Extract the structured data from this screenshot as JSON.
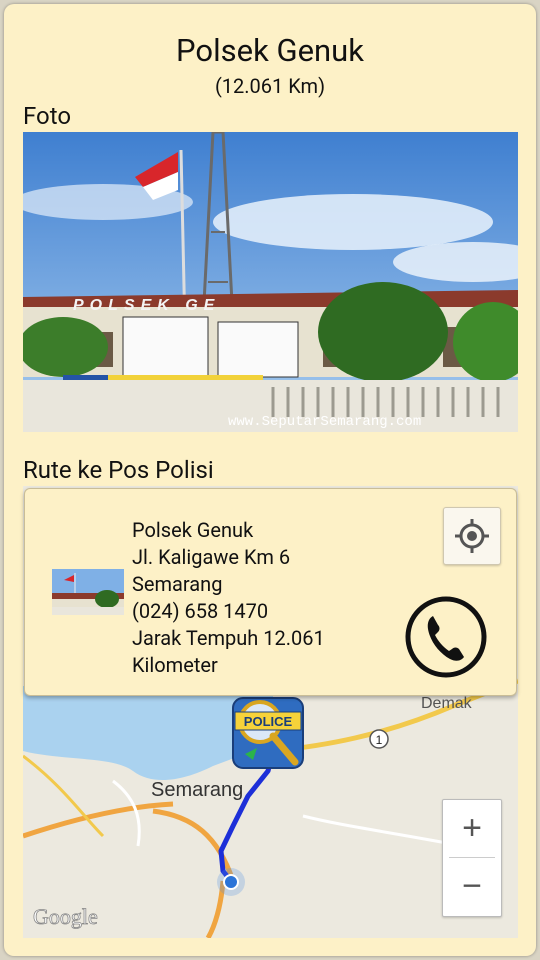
{
  "place": {
    "title": "Polsek Genuk",
    "distance": "(12.061 Km)"
  },
  "sections": {
    "photo_label": "Foto",
    "route_label": "Rute ke Pos Polisi"
  },
  "photo": {
    "watermark": "www.SeputarSemarang.com",
    "sign_text": "POLSEK GE"
  },
  "info": {
    "name": "Polsek Genuk",
    "address_line1": "Jl. Kaligawe Km 6",
    "address_line2": "Semarang",
    "phone": "(024) 658 1470",
    "distance_line1": "Jarak Tempuh 12.061",
    "distance_line2": "Kilometer"
  },
  "map": {
    "city_label": "Semarang",
    "city_label_2": "Demak",
    "road_badge": "1",
    "marker_label": "POLICE",
    "attribution": "Google",
    "zoom_in": "+",
    "zoom_out": "−"
  },
  "colors": {
    "card": "#fdf1c7",
    "route": "#1d2fd8",
    "road": "#f2c94c",
    "sea": "#aad2ef"
  },
  "icons": {
    "locate": "crosshair-icon",
    "call": "phone-icon"
  }
}
